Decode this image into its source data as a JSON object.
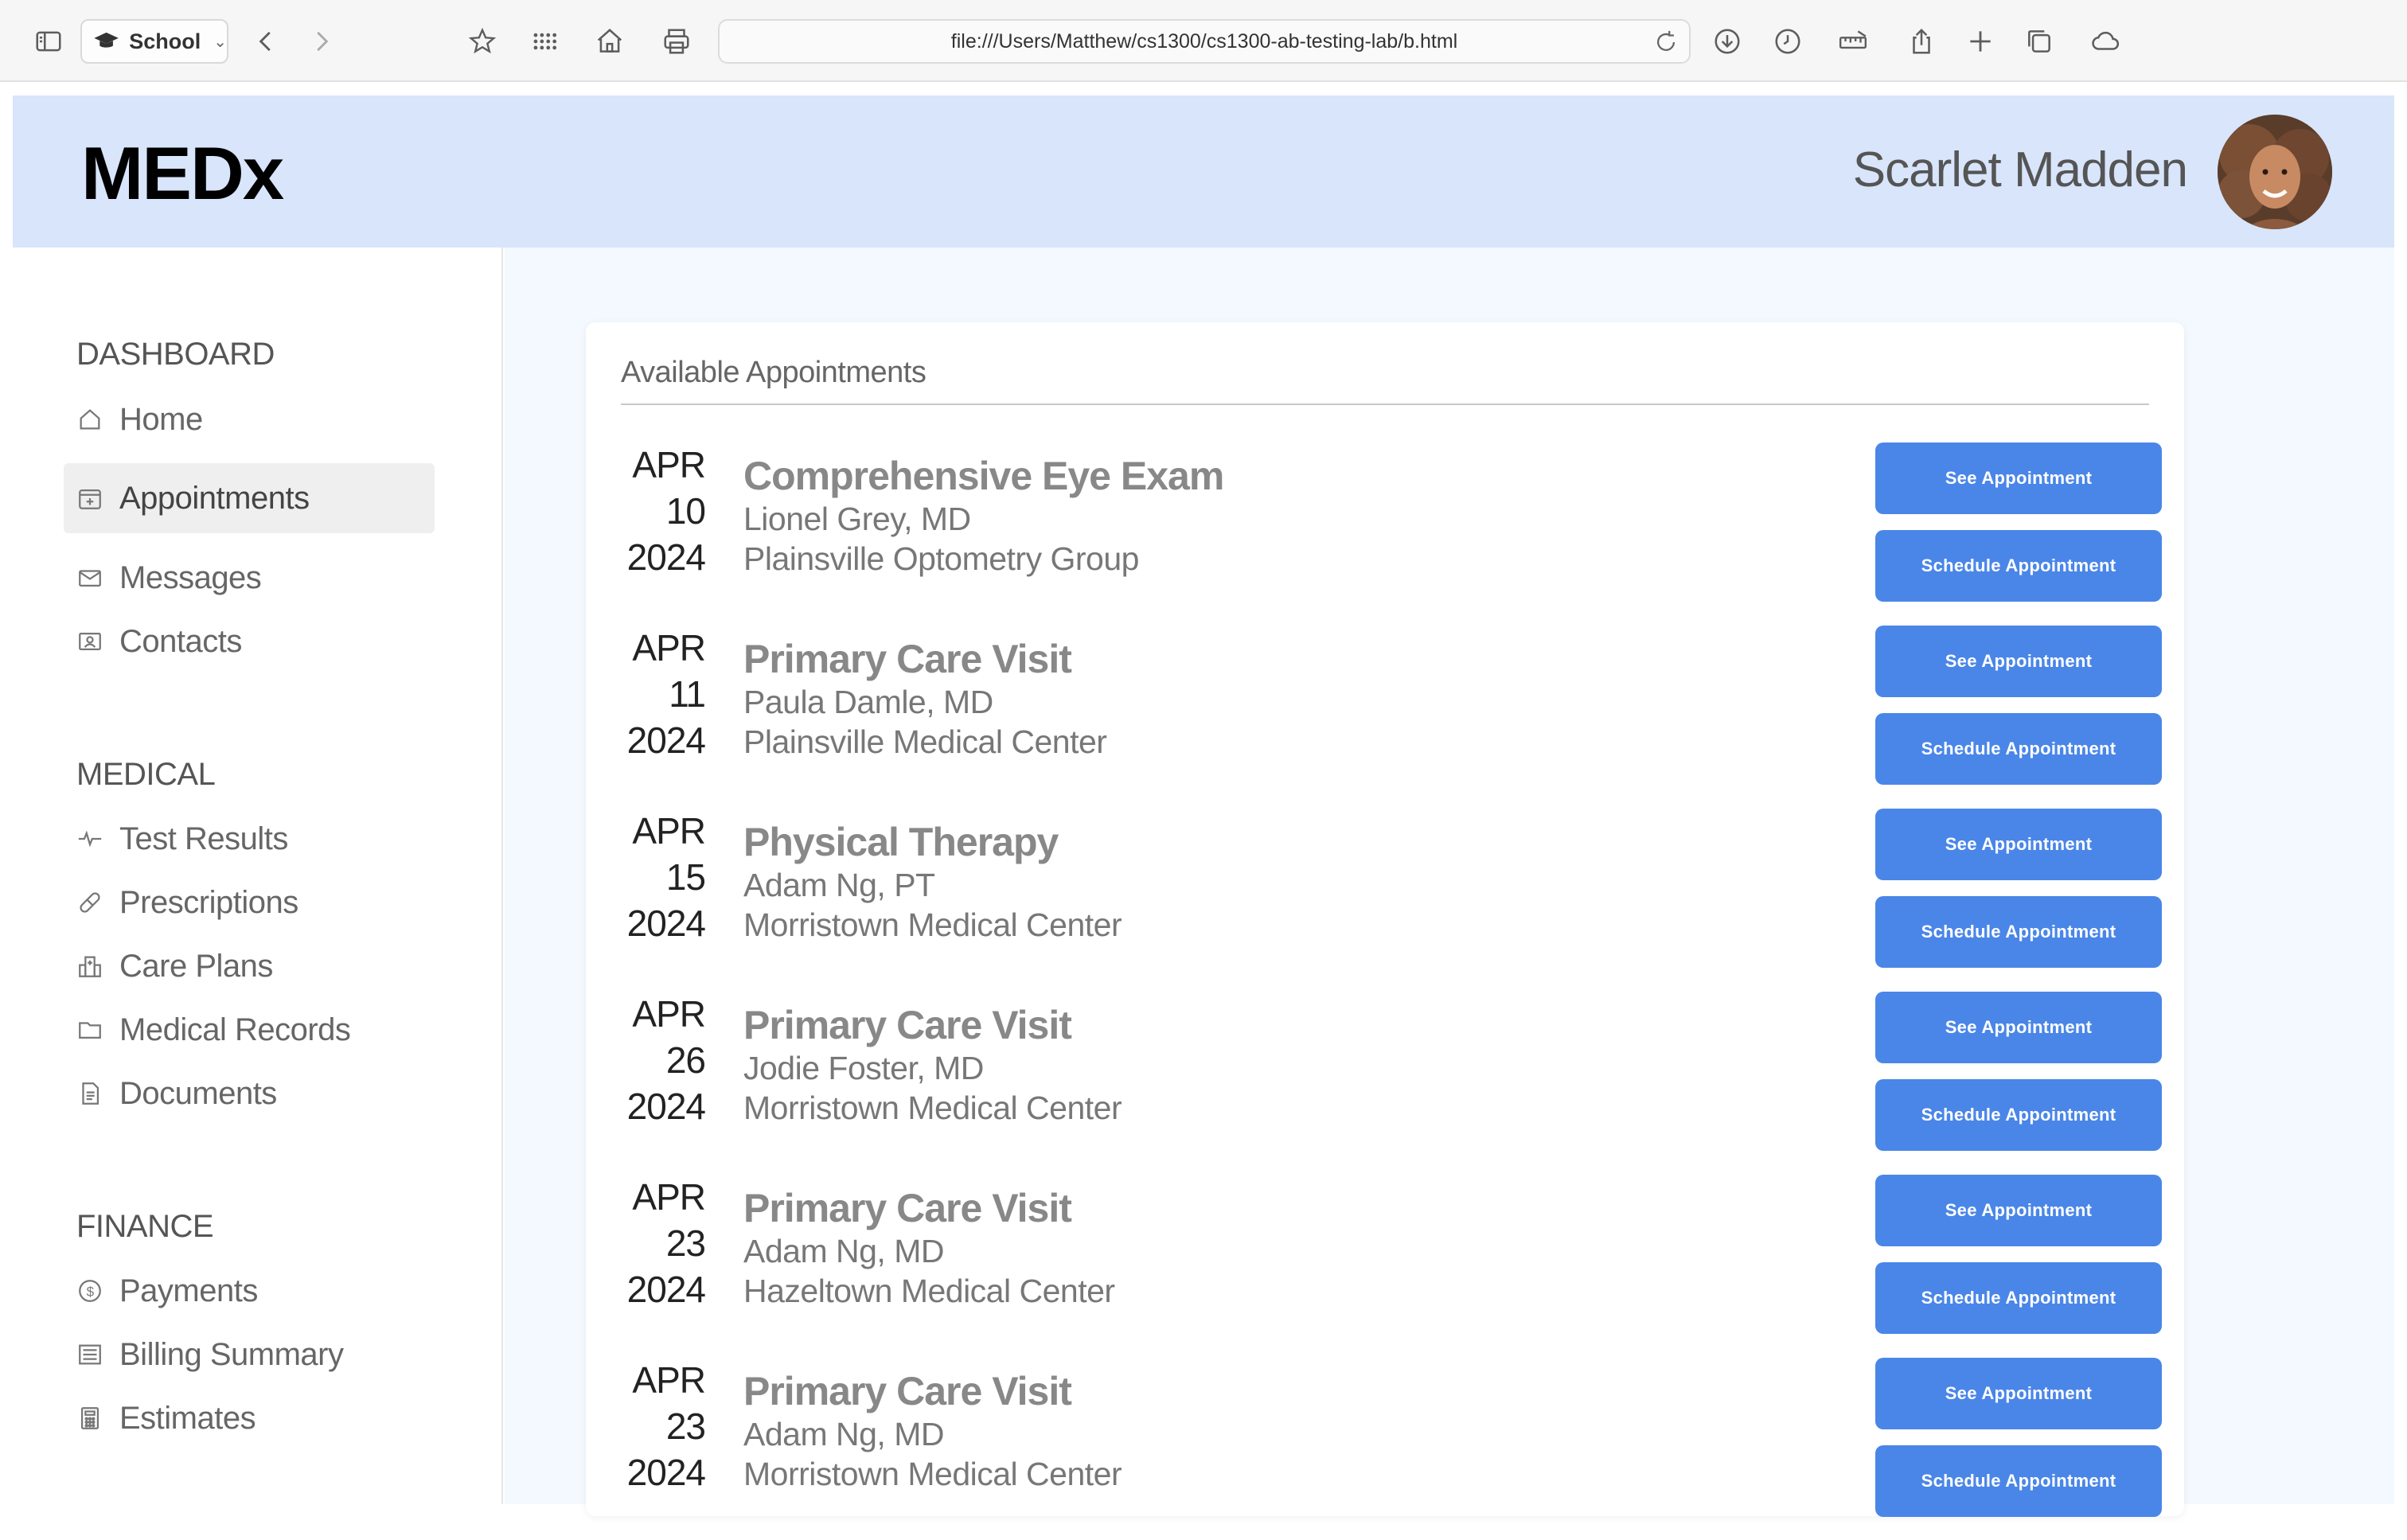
{
  "browser": {
    "profile_label": "School",
    "url": "file:///Users/Matthew/cs1300/cs1300-ab-testing-lab/b.html"
  },
  "header": {
    "brand": "MEDx",
    "user_name": "Scarlet Madden"
  },
  "sidebar": {
    "sections": [
      {
        "title": "DASHBOARD",
        "items": [
          {
            "label": "Home",
            "icon": "home-icon"
          },
          {
            "label": "Appointments",
            "icon": "calendar-icon",
            "active": true
          },
          {
            "label": "Messages",
            "icon": "envelope-icon"
          },
          {
            "label": "Contacts",
            "icon": "contact-card-icon"
          }
        ]
      },
      {
        "title": "MEDICAL",
        "items": [
          {
            "label": "Test Results",
            "icon": "pulse-icon"
          },
          {
            "label": "Prescriptions",
            "icon": "pill-icon"
          },
          {
            "label": "Care Plans",
            "icon": "hospital-icon"
          },
          {
            "label": "Medical Records",
            "icon": "folder-icon"
          },
          {
            "label": "Documents",
            "icon": "document-icon"
          }
        ]
      },
      {
        "title": "FINANCE",
        "items": [
          {
            "label": "Payments",
            "icon": "dollar-coin-icon"
          },
          {
            "label": "Billing Summary",
            "icon": "list-icon"
          },
          {
            "label": "Estimates",
            "icon": "calculator-icon"
          }
        ]
      }
    ]
  },
  "main": {
    "card_title": "Available Appointments",
    "see_label": "See Appointment",
    "schedule_label": "Schedule Appointment",
    "appointments": [
      {
        "month": "APR",
        "day": "10",
        "year": "2024",
        "title": "Comprehensive Eye Exam",
        "doctor": "Lionel Grey, MD",
        "location": "Plainsville Optometry Group"
      },
      {
        "month": "APR",
        "day": "11",
        "year": "2024",
        "title": "Primary Care Visit",
        "doctor": "Paula Damle, MD",
        "location": "Plainsville Medical Center"
      },
      {
        "month": "APR",
        "day": "15",
        "year": "2024",
        "title": "Physical Therapy",
        "doctor": "Adam Ng, PT",
        "location": "Morristown Medical Center"
      },
      {
        "month": "APR",
        "day": "26",
        "year": "2024",
        "title": "Primary Care Visit",
        "doctor": "Jodie Foster, MD",
        "location": "Morristown Medical Center"
      },
      {
        "month": "APR",
        "day": "23",
        "year": "2024",
        "title": "Primary Care Visit",
        "doctor": "Adam Ng, MD",
        "location": "Hazeltown Medical Center"
      },
      {
        "month": "APR",
        "day": "23",
        "year": "2024",
        "title": "Primary Care Visit",
        "doctor": "Adam Ng, MD",
        "location": "Morristown Medical Center"
      }
    ]
  },
  "colors": {
    "header_bg": "#d8e5fb",
    "main_bg": "#f4f8ff",
    "button_bg": "#4a86e8",
    "active_nav_bg": "#efefef"
  }
}
